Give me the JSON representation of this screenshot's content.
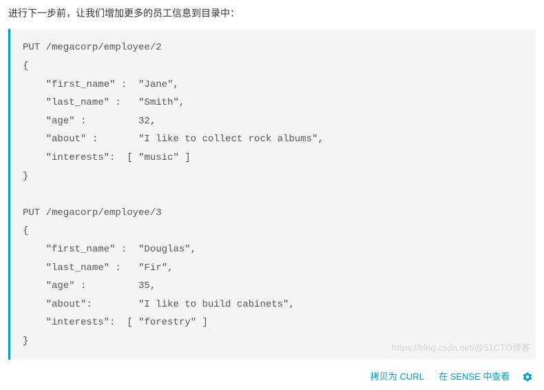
{
  "intro": "进行下一步前，让我们增加更多的员工信息到目录中：",
  "code": "PUT /megacorp/employee/2\n{\n    \"first_name\" :  \"Jane\",\n    \"last_name\" :   \"Smith\",\n    \"age\" :         32,\n    \"about\" :       \"I like to collect rock albums\",\n    \"interests\":  [ \"music\" ]\n}\n\nPUT /megacorp/employee/3\n{\n    \"first_name\" :  \"Douglas\",\n    \"last_name\" :   \"Fir\",\n    \"age\" :         35,\n    \"about\":        \"I like to build cabinets\",\n    \"interests\":  [ \"forestry\" ]\n}",
  "actions": {
    "curl_label": "拷贝为 CURL",
    "sense_label": "在 SENSE 中查看"
  },
  "watermark": "https://blog.csdn.net/@51CTO博客"
}
